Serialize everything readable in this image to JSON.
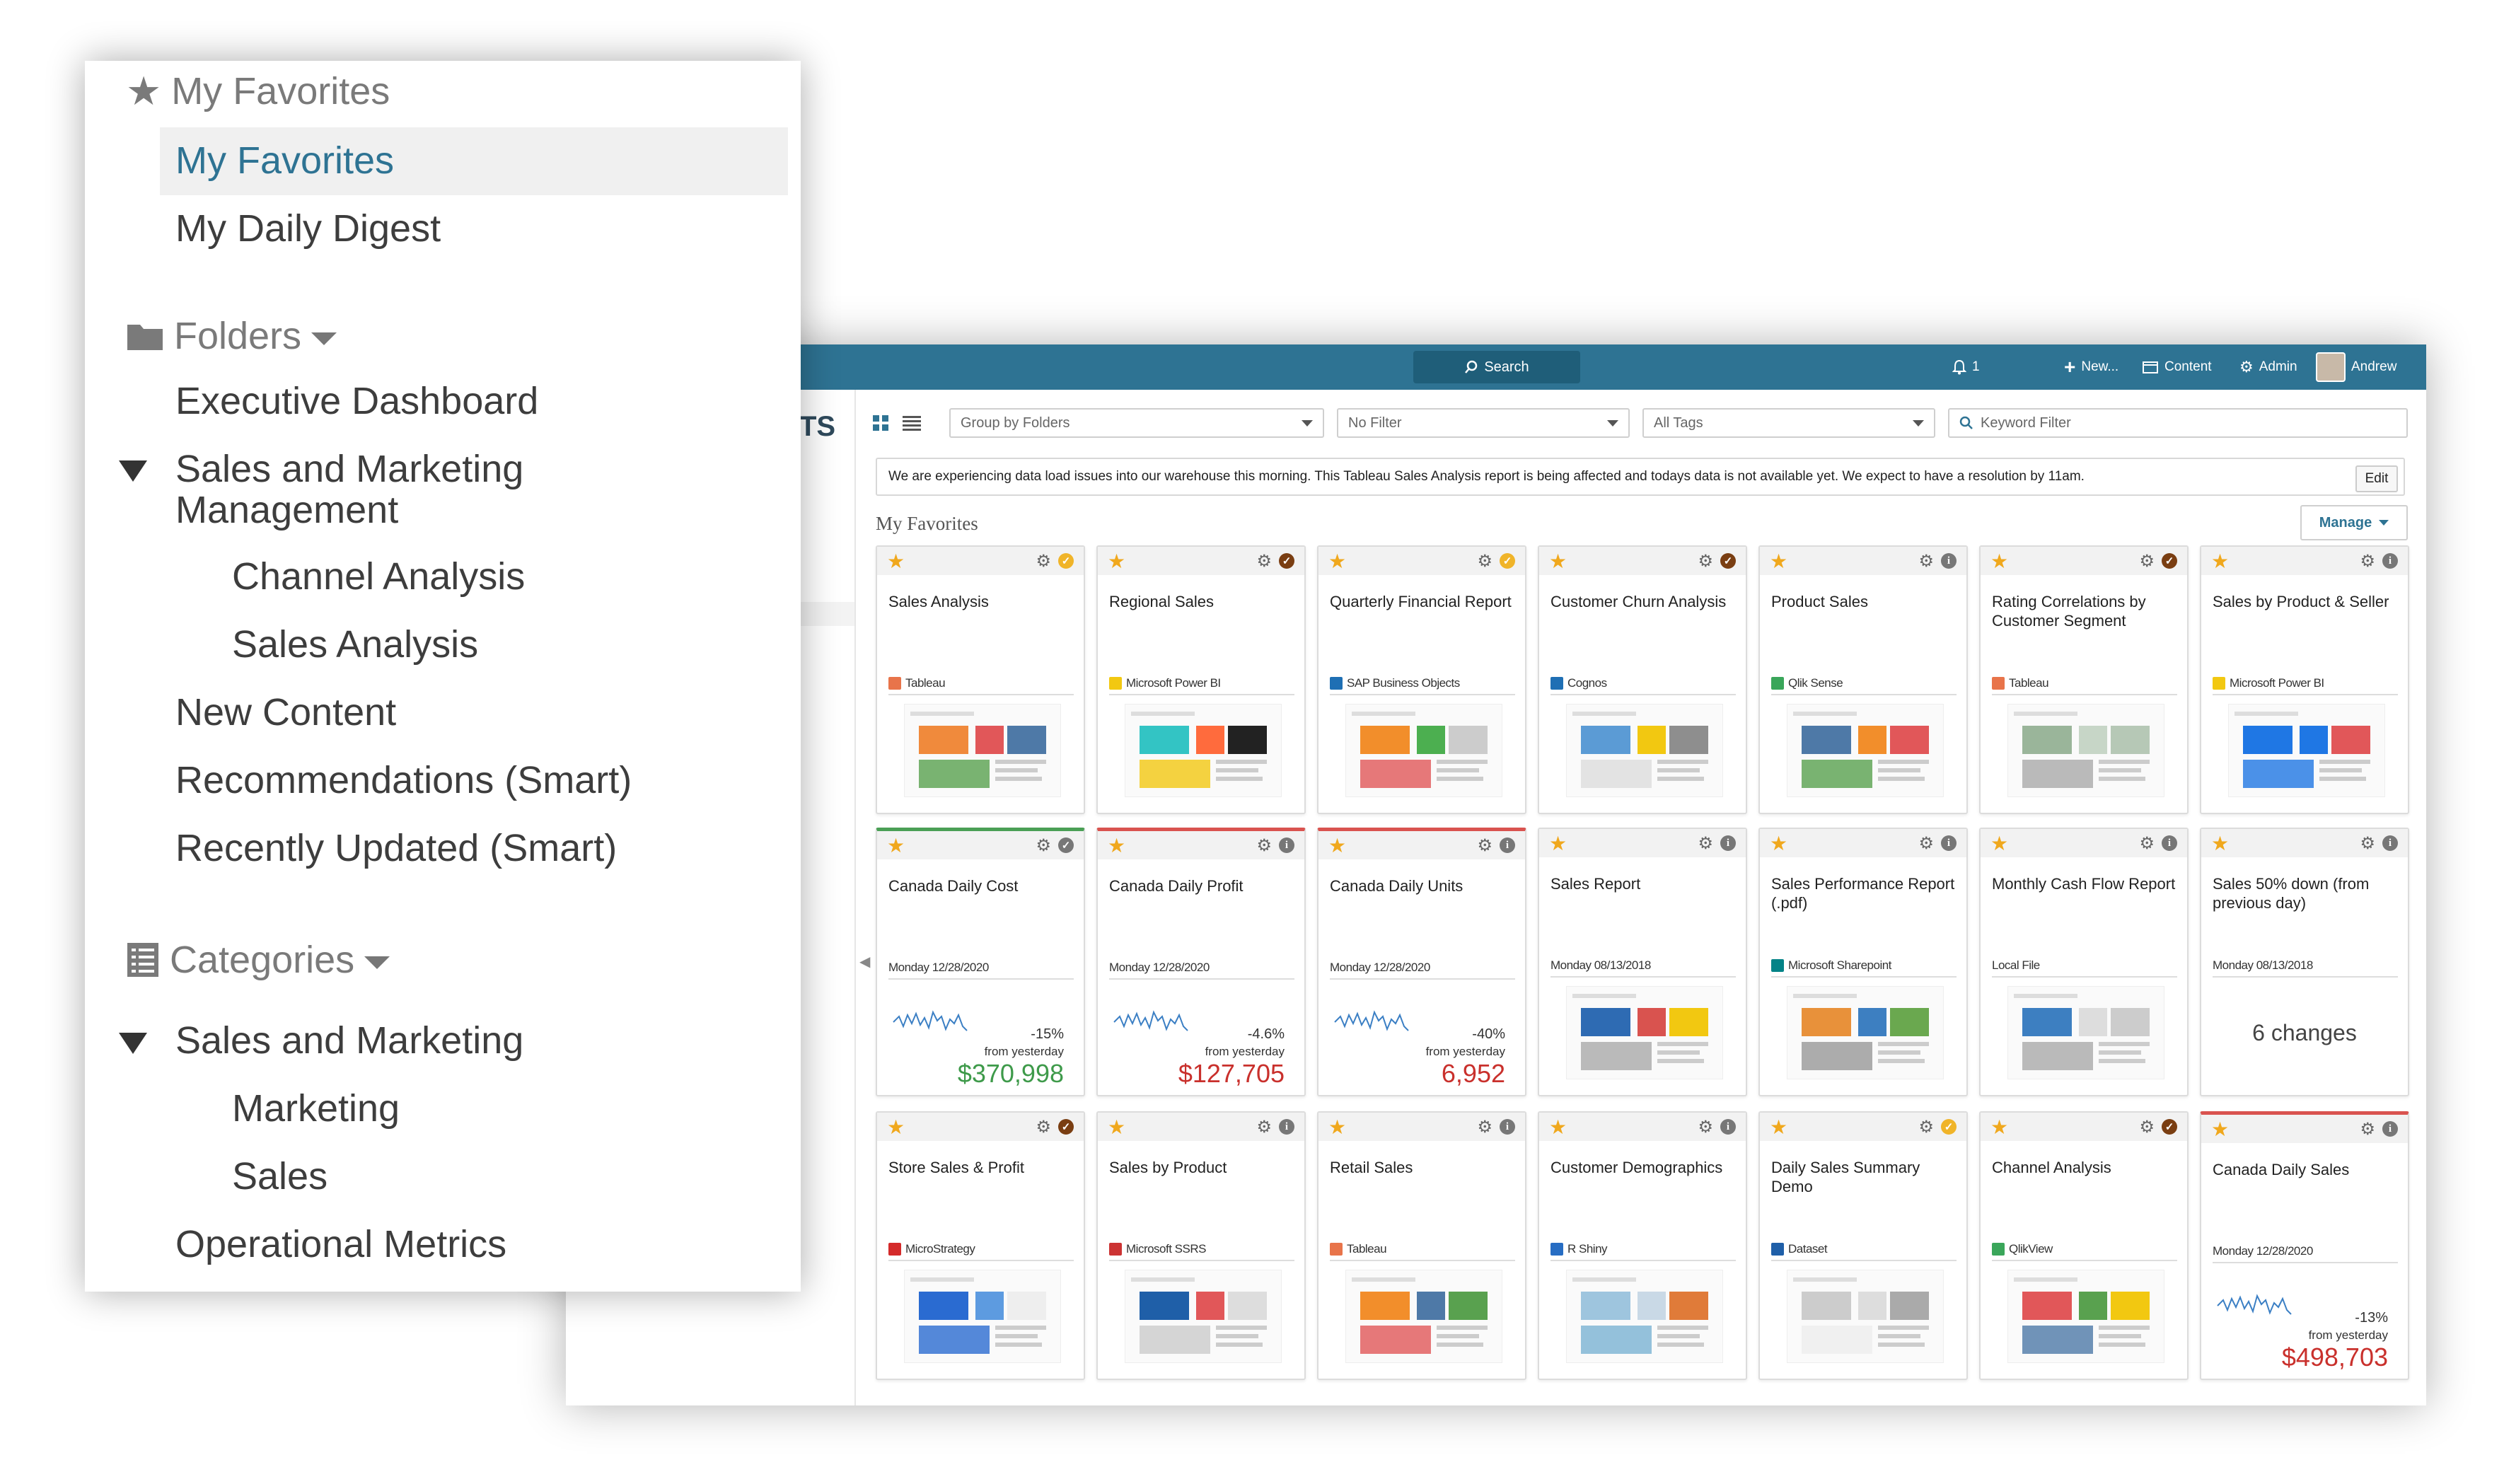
{
  "topbar": {
    "search_label": "Search",
    "notifications_count": "1",
    "new_label": "New...",
    "content_label": "Content",
    "admin_label": "Admin",
    "user_name": "Andrew"
  },
  "toolbar": {
    "group_by": "Group by Folders",
    "filter": "No Filter",
    "tags": "All Tags",
    "keyword_placeholder": "Keyword Filter"
  },
  "left_strip_text": "TS",
  "notice": {
    "text": "We are experiencing data load issues into our warehouse this morning. This Tableau Sales Analysis report is being affected and todays data is not available yet. We expect to have a resolution by 11am.",
    "edit_label": "Edit"
  },
  "section_title": "My Favorites",
  "manage_label": "Manage",
  "cards": [
    {
      "title": "Sales Analysis",
      "source": "Tableau",
      "status": "check-gold"
    },
    {
      "title": "Regional Sales",
      "source": "Microsoft Power BI",
      "status": "check-brown"
    },
    {
      "title": "Quarterly Financial Report",
      "source": "SAP Business Objects",
      "status": "check-gold"
    },
    {
      "title": "Customer Churn Analysis",
      "source": "Cognos",
      "status": "check-brown"
    },
    {
      "title": "Product Sales",
      "source": "Qlik Sense",
      "status": "info"
    },
    {
      "title": "Rating Correlations by Customer Segment",
      "source": "Tableau",
      "status": "check-brown"
    },
    {
      "title": "Sales by Product & Seller",
      "source": "Microsoft Power BI",
      "status": "info"
    },
    {
      "title": "Canada Daily Cost",
      "source": "Monday 12/28/2020",
      "status": "check-gray",
      "change": "-15%",
      "from": "from yesterday",
      "value": "$370,998",
      "value_color": "green"
    },
    {
      "title": "Canada Daily Profit",
      "source": "Monday 12/28/2020",
      "status": "info",
      "change": "-4.6%",
      "from": "from yesterday",
      "value": "$127,705",
      "value_color": "red"
    },
    {
      "title": "Canada Daily Units",
      "source": "Monday 12/28/2020",
      "status": "info",
      "change": "-40%",
      "from": "from yesterday",
      "value": "6,952",
      "value_color": "red"
    },
    {
      "title": "Sales Report",
      "source": "Monday 08/13/2018",
      "status": "info"
    },
    {
      "title": "Sales Performance Report (.pdf)",
      "source": "Microsoft Sharepoint",
      "status": "info"
    },
    {
      "title": "Monthly Cash Flow Report",
      "source": "Local File",
      "status": "info"
    },
    {
      "title": "Sales 50% down (from previous day)",
      "source": "Monday 08/13/2018",
      "status": "info",
      "big_text": "6 changes"
    },
    {
      "title": "Store Sales & Profit",
      "source": "MicroStrategy",
      "status": "check-brown"
    },
    {
      "title": "Sales by Product",
      "source": "Microsoft SSRS",
      "status": "info"
    },
    {
      "title": "Retail Sales",
      "source": "Tableau",
      "status": "info"
    },
    {
      "title": "Customer Demographics",
      "source": "R Shiny",
      "status": "info"
    },
    {
      "title": "Daily Sales Summary Demo",
      "source": "Dataset",
      "status": "check-gold"
    },
    {
      "title": "Channel Analysis",
      "source": "QlikView",
      "status": "check-brown"
    },
    {
      "title": "Canada Daily Sales",
      "source": "Monday 12/28/2020",
      "status": "info",
      "change": "-13%",
      "from": "from yesterday",
      "value": "$498,703",
      "value_color": "red"
    }
  ],
  "sidebar": {
    "favorites_header": "My Favorites",
    "favorites_items": [
      "My Favorites",
      "My Daily Digest"
    ],
    "folders_header": "Folders",
    "folders_items": [
      "Executive Dashboard",
      "Sales and Marketing Management",
      "Channel Analysis",
      "Sales Analysis",
      "New Content",
      "Recommendations (Smart)",
      "Recently Updated (Smart)"
    ],
    "categories_header": "Categories",
    "categories_items": [
      "Sales and Marketing",
      "Marketing",
      "Sales",
      "Operational Metrics"
    ]
  }
}
